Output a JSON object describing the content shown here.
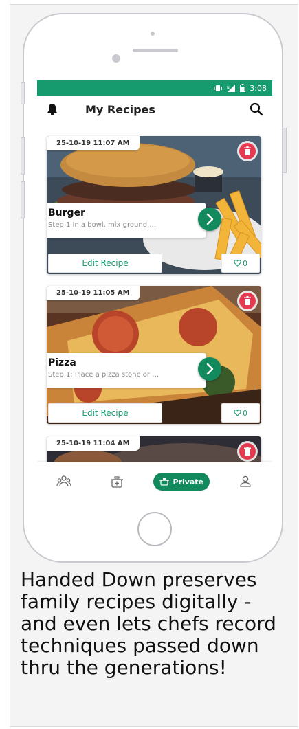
{
  "status": {
    "time": "3:08"
  },
  "header": {
    "title": "My Recipes"
  },
  "recipes": [
    {
      "date": "25-10-19 11:07 AM",
      "name": "Burger",
      "step": "Step 1 In a bowl, mix ground …",
      "edit_label": "Edit Recipe",
      "likes": "0"
    },
    {
      "date": "25-10-19 11:05 AM",
      "name": "Pizza",
      "step": "Step 1: Place a pizza stone or …",
      "edit_label": "Edit Recipe",
      "likes": "0"
    },
    {
      "date": "25-10-19 11:04 AM"
    }
  ],
  "nav": {
    "private_label": "Private"
  },
  "caption": "Handed Down preserves family recipes digitally - and even lets chefs record techniques passed down thru the generations!",
  "colors": {
    "primary": "#169b6e",
    "primary_dark": "#128a5e",
    "danger": "#e53950"
  },
  "icons": [
    "bell-icon",
    "search-icon",
    "trash-icon",
    "chevron-right-icon",
    "heart-icon",
    "community-icon",
    "add-recipe-icon",
    "pot-icon",
    "profile-icon"
  ]
}
